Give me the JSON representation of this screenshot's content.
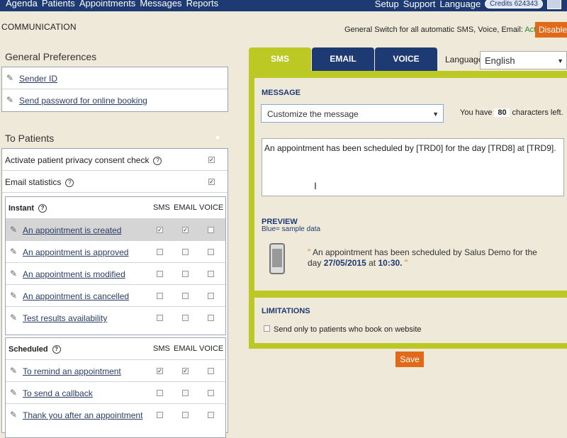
{
  "nav": {
    "left": [
      "Agenda",
      "Patients",
      "Appointments",
      "Messages",
      "Reports"
    ],
    "right": [
      "Setup",
      "Support",
      "Language"
    ],
    "credits": "Credits 624343"
  },
  "header": {
    "title": "COMMUNICATION",
    "switch_label": "General Switch for all automatic SMS, Voice, Email:",
    "switch_status": "Active",
    "disable_label": "Disable"
  },
  "general": {
    "title": "General Preferences",
    "items": [
      "Sender ID",
      "Send password for online booking"
    ]
  },
  "patients": {
    "title": "To Patients",
    "privacy": "Activate patient privacy consent check",
    "email_stats": "Email statistics"
  },
  "instant": {
    "title": "Instant",
    "cols": [
      "SMS",
      "EMAIL",
      "VOICE"
    ],
    "rows": [
      {
        "label": "An appointment is created",
        "sms": true,
        "email": true,
        "voice": false
      },
      {
        "label": "An appointment is approved",
        "sms": false,
        "email": false,
        "voice": false
      },
      {
        "label": "An appointment is modified",
        "sms": false,
        "email": false,
        "voice": false
      },
      {
        "label": "An appointment is cancelled",
        "sms": false,
        "email": false,
        "voice": false
      },
      {
        "label": "Test results availability",
        "sms": false,
        "email": false,
        "voice": false
      }
    ]
  },
  "scheduled": {
    "title": "Scheduled",
    "cols": [
      "SMS",
      "EMAIL",
      "VOICE"
    ],
    "rows": [
      {
        "label": "To remind an appointment",
        "sms": true,
        "email": true,
        "voice": false
      },
      {
        "label": "To send a callback",
        "sms": false,
        "email": false,
        "voice": false
      },
      {
        "label": "Thank you after an appointment",
        "sms": false,
        "email": false,
        "voice": false
      }
    ]
  },
  "tabs": [
    "SMS",
    "EMAIL",
    "VOICE"
  ],
  "language": {
    "label": "Language",
    "value": "English"
  },
  "message": {
    "title": "MESSAGE",
    "select": "Customize the message",
    "chars_prefix": "You have",
    "chars_count": "80",
    "chars_suffix": "characters left.",
    "text": "An appointment has been scheduled by [TRD0] for the day [TRD8] at [TRD9]."
  },
  "preview": {
    "title": "PREVIEW",
    "subtitle": "Blue= sample data",
    "text_before": "An appointment has been scheduled by Salus Demo for the day",
    "date": "27/05/2015",
    "at": "at",
    "time": "10:30."
  },
  "limitations": {
    "title": "LIMITATIONS",
    "option": "Send only to patients who book on website"
  },
  "save_label": "Save"
}
